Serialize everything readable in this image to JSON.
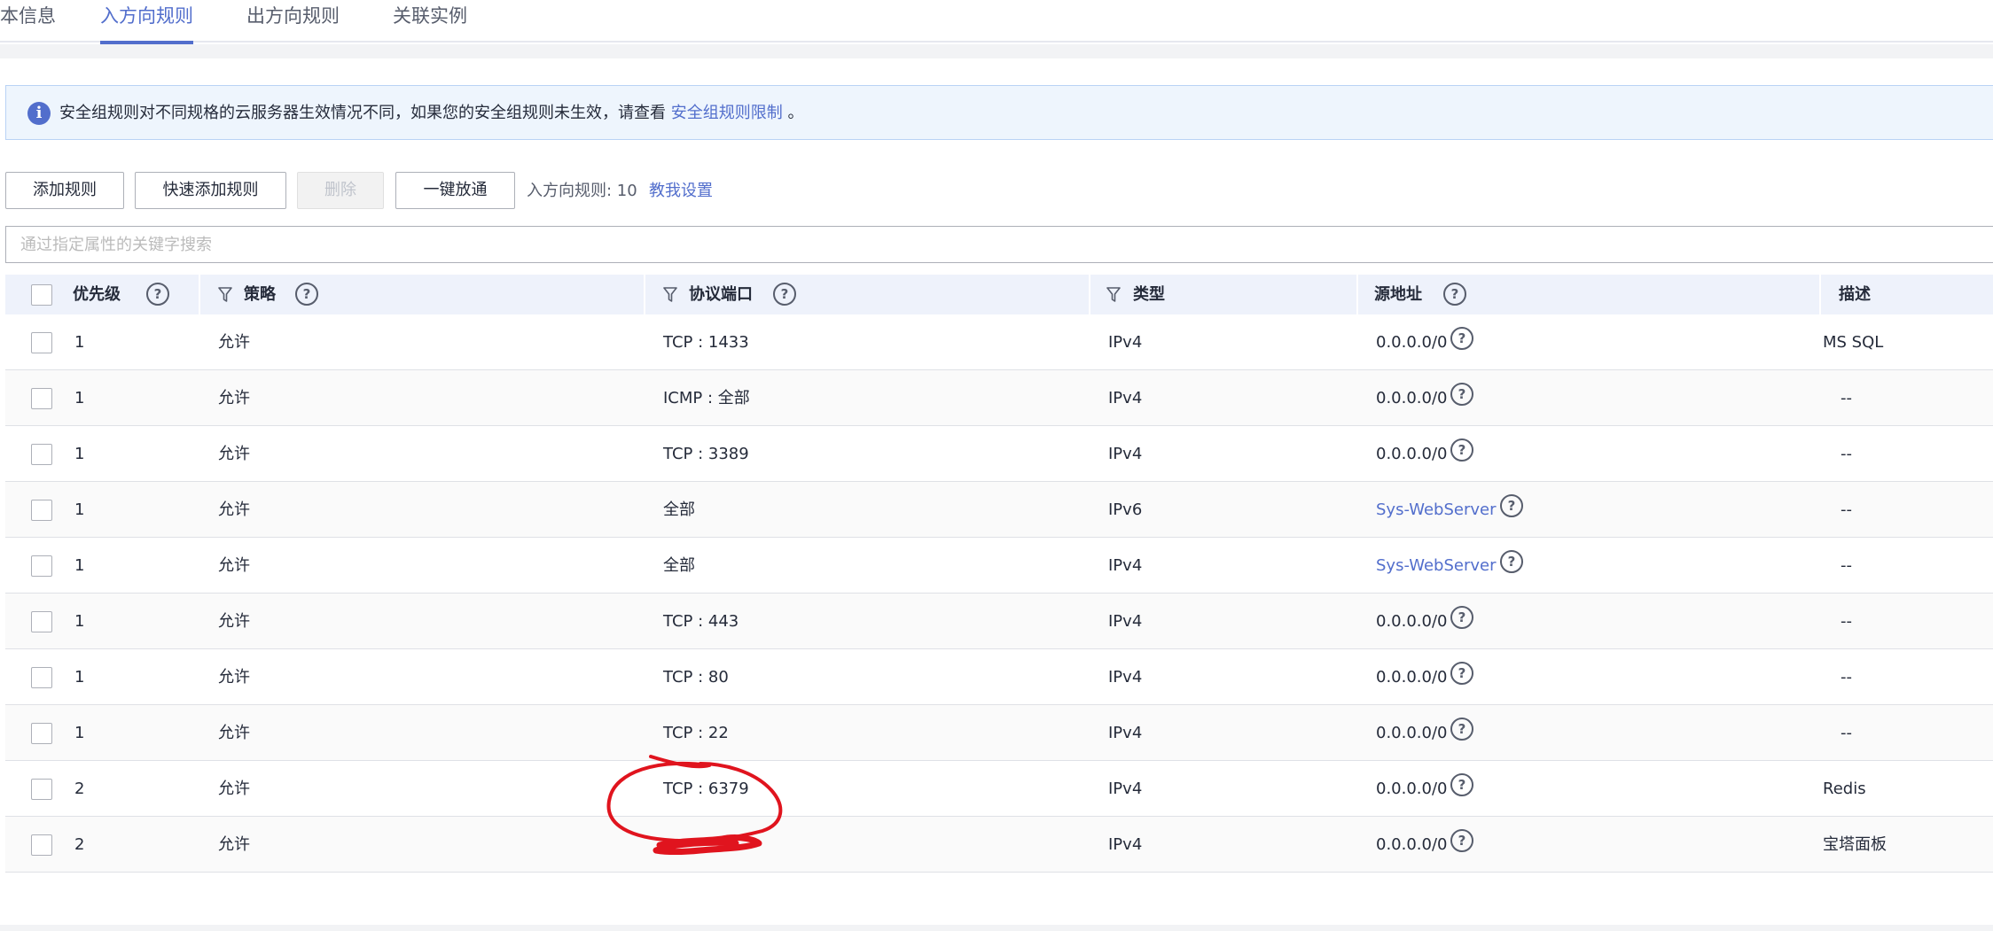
{
  "tabs": [
    {
      "label": "本信息",
      "active": false
    },
    {
      "label": "入方向规则",
      "active": true
    },
    {
      "label": "出方向规则",
      "active": false
    },
    {
      "label": "关联实例",
      "active": false
    }
  ],
  "alert": {
    "icon": "info-icon",
    "text": "安全组规则对不同规格的云服务器生效情况不同，如果您的安全组规则未生效，请查看",
    "link": "安全组规则限制",
    "suffix": "。"
  },
  "toolbar": {
    "add_rule": "添加规则",
    "quick_add_rule": "快速添加规则",
    "delete": "删除",
    "open_all": "一键放通",
    "rule_count_label": "入方向规则: 10",
    "help_link": "教我设置"
  },
  "search": {
    "placeholder": "通过指定属性的关键字搜索",
    "value": ""
  },
  "table": {
    "headers": {
      "priority": "优先级",
      "policy": "策略",
      "protocol_port": "协议端口",
      "type": "类型",
      "source": "源地址",
      "description": "描述"
    },
    "rows": [
      {
        "priority": "1",
        "policy": "允许",
        "protocol_port": "TCP : 1433",
        "type": "IPv4",
        "source": "0.0.0.0/0",
        "source_is_link": false,
        "description": "MS SQL"
      },
      {
        "priority": "1",
        "policy": "允许",
        "protocol_port": "ICMP : 全部",
        "type": "IPv4",
        "source": "0.0.0.0/0",
        "source_is_link": false,
        "description": "--"
      },
      {
        "priority": "1",
        "policy": "允许",
        "protocol_port": "TCP : 3389",
        "type": "IPv4",
        "source": "0.0.0.0/0",
        "source_is_link": false,
        "description": "--"
      },
      {
        "priority": "1",
        "policy": "允许",
        "protocol_port": "全部",
        "type": "IPv6",
        "source": "Sys-WebServer",
        "source_is_link": true,
        "description": "--"
      },
      {
        "priority": "1",
        "policy": "允许",
        "protocol_port": "全部",
        "type": "IPv4",
        "source": "Sys-WebServer",
        "source_is_link": true,
        "description": "--"
      },
      {
        "priority": "1",
        "policy": "允许",
        "protocol_port": "TCP : 443",
        "type": "IPv4",
        "source": "0.0.0.0/0",
        "source_is_link": false,
        "description": "--"
      },
      {
        "priority": "1",
        "policy": "允许",
        "protocol_port": "TCP : 80",
        "type": "IPv4",
        "source": "0.0.0.0/0",
        "source_is_link": false,
        "description": "--"
      },
      {
        "priority": "1",
        "policy": "允许",
        "protocol_port": "TCP : 22",
        "type": "IPv4",
        "source": "0.0.0.0/0",
        "source_is_link": false,
        "description": "--"
      },
      {
        "priority": "2",
        "policy": "允许",
        "protocol_port": "TCP : 6379",
        "type": "IPv4",
        "source": "0.0.0.0/0",
        "source_is_link": false,
        "description": "Redis"
      },
      {
        "priority": "2",
        "policy": "允许",
        "protocol_port": "",
        "type": "IPv4",
        "source": "0.0.0.0/0",
        "source_is_link": false,
        "description": "宝塔面板"
      }
    ]
  },
  "colors": {
    "accent": "#526ecc",
    "annotation": "#e0141e"
  }
}
